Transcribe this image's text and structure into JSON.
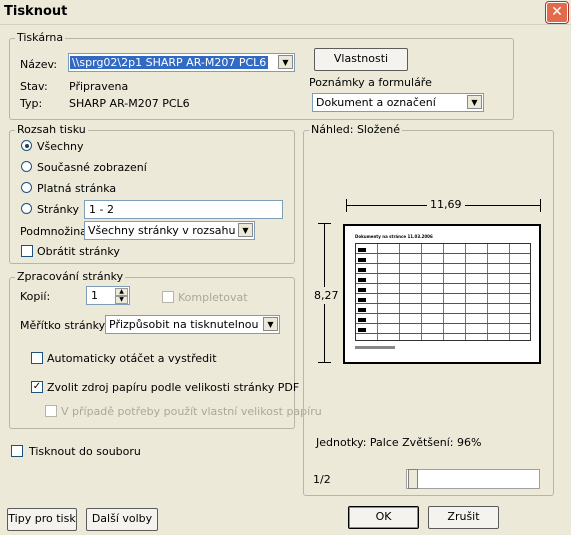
{
  "window": {
    "title": "Tisknout",
    "close": "✕"
  },
  "printer": {
    "group": "Tiskárna",
    "name_label": "Název:",
    "name_value": "\\\\sprg02\\2p1 SHARP AR-M207 PCL6",
    "status_label": "Stav:",
    "status_value": "Připravena",
    "type_label": "Typ:",
    "type_value": "SHARP AR-M207 PCL6",
    "properties_btn": "Vlastnosti",
    "notes_label": "Poznámky a formuláře",
    "notes_value": "Dokument a označení"
  },
  "range": {
    "group": "Rozsah tisku",
    "all": "Všechny",
    "current_view": "Současné zobrazení",
    "current_page": "Platná stránka",
    "pages": "Stránky",
    "pages_value": "1 - 2",
    "subset_label": "Podmnožina:",
    "subset_value": "Všechny stránky v rozsahu",
    "reverse": "Obrátit stránky"
  },
  "handling": {
    "group": "Zpracování stránky",
    "copies_label": "Kopií:",
    "copies_value": "1",
    "collate": "Kompletovat",
    "scale_label": "Měřítko stránky:",
    "scale_value": "Přizpůsobit na tisknutelnou ploch",
    "auto_rotate": "Automaticky otáčet a vystředit",
    "choose_source": "Zvolit zdroj papíru podle velikosti stránky PDF",
    "custom_size": "V případě potřeby použít vlastní velikost papíru"
  },
  "print_to_file": "Tisknout do souboru",
  "preview": {
    "group": "Náhled: Složené",
    "width": "11,69",
    "height": "8,27",
    "doc_title": "Dokumenty na stránce 11.03.2006",
    "units": "Jednotky: Palce Zvětšení:  96%",
    "page": "1/2"
  },
  "buttons": {
    "tips": "Tipy pro tisk",
    "more": "Další volby",
    "ok": "OK",
    "cancel": "Zrušit"
  }
}
